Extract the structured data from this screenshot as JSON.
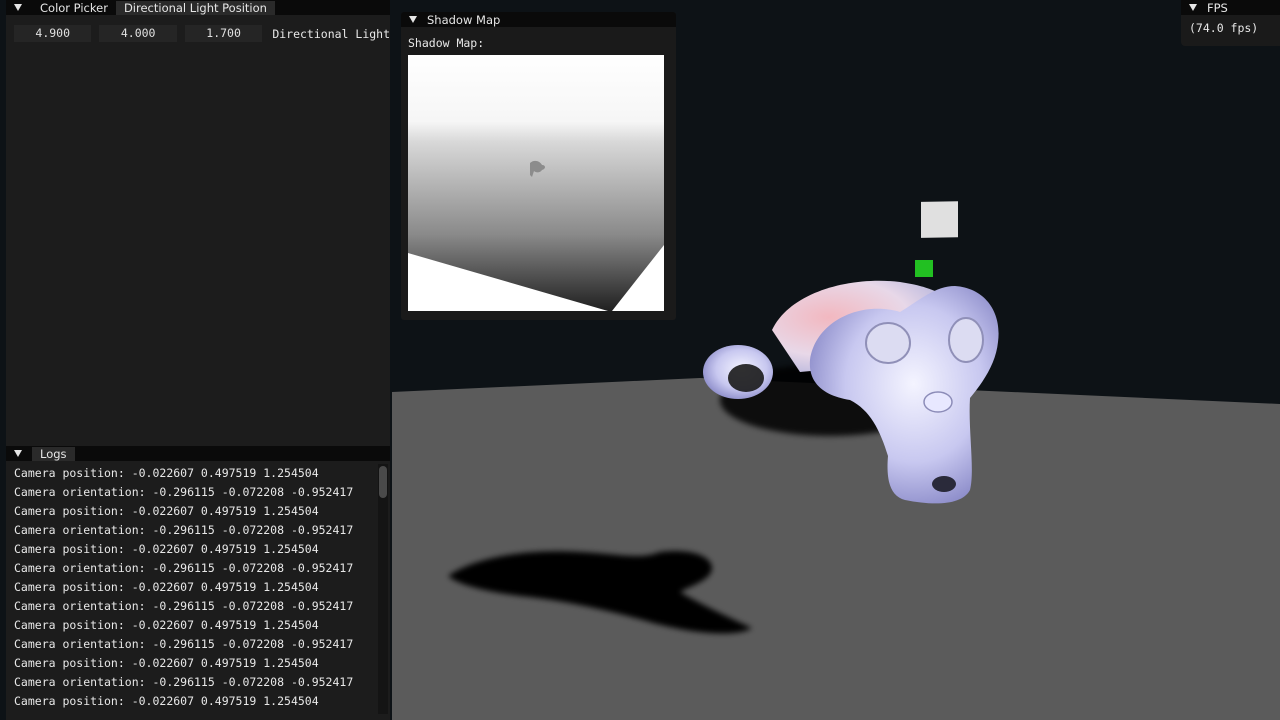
{
  "color_picker_window": {
    "tabs": [
      "Color Picker",
      "Directional Light Position"
    ],
    "position": {
      "x": "4.900",
      "y": "4.000",
      "z": "1.700"
    },
    "label": "Directional Light"
  },
  "logs_window": {
    "title": "Logs",
    "lines": [
      "Camera position: -0.022607 0.497519 1.254504",
      "Camera orientation: -0.296115 -0.072208 -0.952417",
      "Camera position: -0.022607 0.497519 1.254504",
      "Camera orientation: -0.296115 -0.072208 -0.952417",
      "Camera position: -0.022607 0.497519 1.254504",
      "Camera orientation: -0.296115 -0.072208 -0.952417",
      "Camera position: -0.022607 0.497519 1.254504",
      "Camera orientation: -0.296115 -0.072208 -0.952417",
      "Camera position: -0.022607 0.497519 1.254504",
      "Camera orientation: -0.296115 -0.072208 -0.952417",
      "Camera position: -0.022607 0.497519 1.254504",
      "Camera orientation: -0.296115 -0.072208 -0.952417",
      "Camera position: -0.022607 0.497519 1.254504"
    ]
  },
  "shadow_map_window": {
    "title": "Shadow Map",
    "label": "Shadow Map:"
  },
  "fps_window": {
    "title": "FPS",
    "value": "(74.0 fps)"
  },
  "colors": {
    "background": "#0d1216",
    "floor": "#5b5b5b",
    "light_marker": "#22c022",
    "light_cube": "#e0e0e0"
  }
}
